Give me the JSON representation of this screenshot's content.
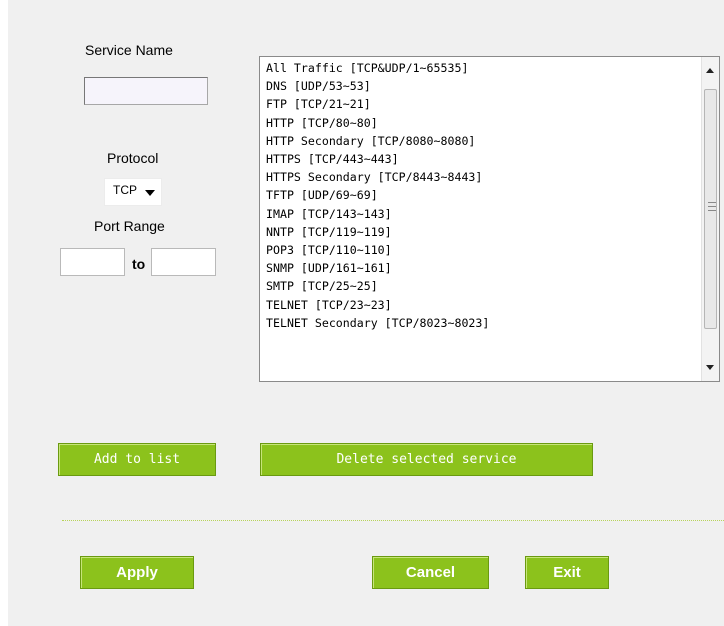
{
  "service_name": {
    "label": "Service Name",
    "value": ""
  },
  "protocol": {
    "label": "Protocol",
    "selected": "TCP"
  },
  "port_range": {
    "label": "Port Range",
    "separator": "to",
    "from": "",
    "to": ""
  },
  "services": [
    "All Traffic [TCP&UDP/1~65535]",
    "DNS [UDP/53~53]",
    "FTP [TCP/21~21]",
    "HTTP [TCP/80~80]",
    "HTTP Secondary [TCP/8080~8080]",
    "HTTPS [TCP/443~443]",
    "HTTPS Secondary [TCP/8443~8443]",
    "TFTP [UDP/69~69]",
    "IMAP [TCP/143~143]",
    "NNTP [TCP/119~119]",
    "POP3 [TCP/110~110]",
    "SNMP [UDP/161~161]",
    "SMTP [TCP/25~25]",
    "TELNET [TCP/23~23]",
    "TELNET Secondary [TCP/8023~8023]"
  ],
  "buttons": {
    "add_to_list": "Add to list",
    "delete_selected": "Delete selected service",
    "apply": "Apply",
    "cancel": "Cancel",
    "exit": "Exit"
  },
  "colors": {
    "button_green": "#8cc21c",
    "panel_bg": "#f0f0f0"
  }
}
